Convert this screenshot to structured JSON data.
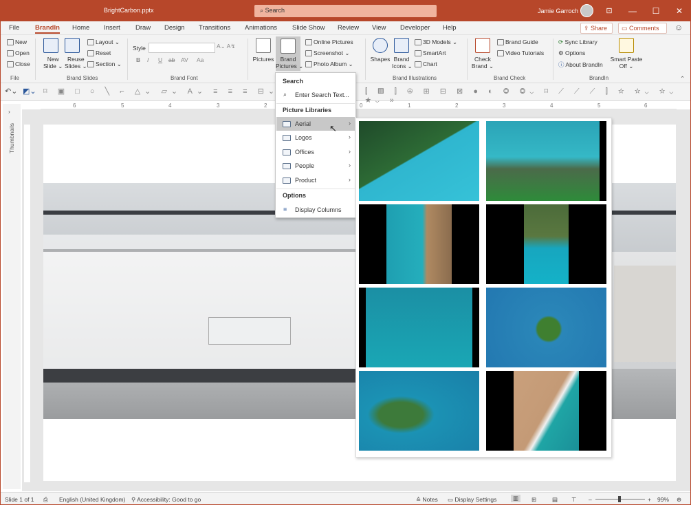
{
  "titlebar": {
    "filename": "BrightCarbon.pptx",
    "search_label": "Search",
    "user_name": "Jamie Garroch",
    "minimize": "—",
    "maximize": "☐",
    "close": "✕"
  },
  "menu": {
    "tabs": [
      "File",
      "BrandIn",
      "Home",
      "Insert",
      "Draw",
      "Design",
      "Transitions",
      "Animations",
      "Slide Show",
      "Review",
      "View",
      "Developer",
      "Help"
    ],
    "active_tab": "BrandIn",
    "share_label": "Share",
    "comments_label": "Comments"
  },
  "ribbon": {
    "file_group": {
      "new": "New",
      "open": "Open",
      "close": "Close",
      "label": "File"
    },
    "brand_slides": {
      "new_slide": "New",
      "new_slide2": "Slide ⌄",
      "reuse": "Reuse",
      "reuse2": "Slides ⌄",
      "layout": "Layout ⌄",
      "reset": "Reset",
      "section": "Section ⌄",
      "label": "Brand Slides"
    },
    "brand_font": {
      "style": "Style",
      "bold": "B",
      "italic": "I",
      "underline": "U",
      "strike": "ab",
      "spacing": "AV",
      "case": "Aa",
      "label": "Brand Font"
    },
    "pictures": {
      "pictures": "Pictures",
      "brand_pictures": "Brand",
      "brand_pictures2": "Pictures ⌄",
      "online_pictures": "Online Pictures",
      "screenshot": "Screenshot ⌄",
      "photo_album": "Photo Album ⌄"
    },
    "brand_illustrations": {
      "shapes": "Shapes",
      "brand_icons": "Brand",
      "brand_icons2": "Icons ⌄",
      "models_3d": "3D Models ⌄",
      "smartart": "SmartArt",
      "chart": "Chart",
      "label": "Brand Illustrations"
    },
    "brand_check": {
      "check": "Check",
      "check2": "Brand ⌄",
      "brand_guide": "Brand Guide",
      "video_tutorials": "Video Tutorials",
      "label": "Brand Check"
    },
    "brandin": {
      "sync": "Sync Library",
      "options": "Options",
      "about": "About BrandIn",
      "smart_paste": "Smart Paste",
      "smart_paste2": "Off ⌄",
      "label": "BrandIn"
    }
  },
  "dropdown": {
    "search_heading": "Search",
    "search_item": "Enter Search Text...",
    "libraries_heading": "Picture Libraries",
    "libraries": [
      "Aerial",
      "Logos",
      "Offices",
      "People",
      "Product"
    ],
    "hovered": "Aerial",
    "options_heading": "Options",
    "options_item": "Display Columns"
  },
  "gallery": {
    "count": 8
  },
  "thumbnails_label": "Thumbnails",
  "status": {
    "slide": "Slide 1 of 1",
    "language": "English (United Kingdom)",
    "accessibility": "Accessibility: Good to go",
    "notes": "Notes",
    "display_settings": "Display Settings",
    "zoom": "99%"
  },
  "ruler_numbers": [
    "6",
    "5",
    "4",
    "3",
    "2",
    "0",
    "1",
    "2",
    "3",
    "4",
    "5",
    "6"
  ]
}
